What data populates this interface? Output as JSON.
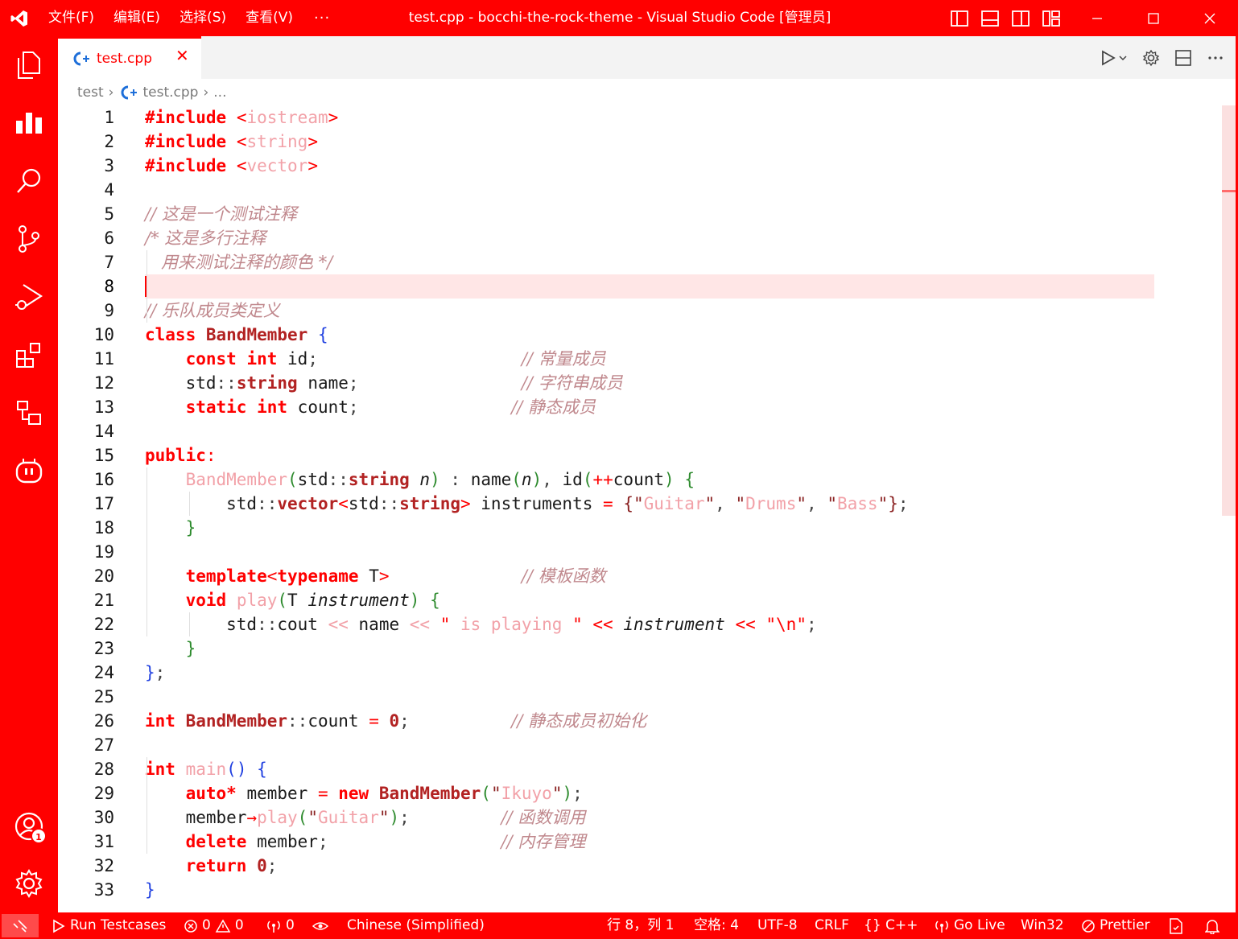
{
  "titlebar": {
    "menus": [
      "文件(F)",
      "编辑(E)",
      "选择(S)",
      "查看(V)"
    ],
    "more": "···",
    "title": "test.cpp - bocchi-the-rock-theme - Visual Studio Code [管理员]"
  },
  "tab": {
    "label": "test.cpp",
    "close": "✕"
  },
  "breadcrumb": {
    "folder": "test",
    "file": "test.cpp",
    "more": "..."
  },
  "editor": {
    "current_line": 8
  },
  "statusbar": {
    "run_testcases": "Run Testcases",
    "errors": "0",
    "warnings": "0",
    "ports": "0",
    "language_pack": "Chinese (Simplified)",
    "cursor": "行 8，列 1",
    "spaces": "空格: 4",
    "encoding": "UTF-8",
    "eol": "CRLF",
    "language": "{} C++",
    "go_live": "Go Live",
    "platform": "Win32",
    "prettier": "Prettier"
  },
  "accounts_badge": "1",
  "colors": {
    "accent": "#ff0000",
    "string": "#f2a1a8",
    "comment": "#c0888d",
    "current_line": "#ffe6e6"
  },
  "code_lines": [
    [
      [
        "pp",
        "#include"
      ],
      [
        "",
        "&nbsp;"
      ],
      [
        "op",
        "<"
      ],
      [
        "str",
        "iostream"
      ],
      [
        "op",
        ">"
      ]
    ],
    [
      [
        "pp",
        "#include"
      ],
      [
        "",
        "&nbsp;"
      ],
      [
        "op",
        "<"
      ],
      [
        "str",
        "string"
      ],
      [
        "op",
        ">"
      ]
    ],
    [
      [
        "pp",
        "#include"
      ],
      [
        "",
        "&nbsp;"
      ],
      [
        "op",
        "<"
      ],
      [
        "str",
        "vector"
      ],
      [
        "op",
        ">"
      ]
    ],
    [],
    [
      [
        "cm",
        "// 这是一个测试注释"
      ]
    ],
    [
      [
        "cm",
        "/* 这是多行注释"
      ]
    ],
    [
      [
        "cm",
        "   用来测试注释的颜色 */"
      ]
    ],
    [],
    [
      [
        "cm",
        "// 乐队成员类定义"
      ]
    ],
    [
      [
        "kw",
        "class"
      ],
      [
        "",
        "&nbsp;"
      ],
      [
        "ty",
        "BandMember"
      ],
      [
        "",
        "&nbsp;"
      ],
      [
        "br1",
        "{"
      ]
    ],
    [
      [
        "",
        "    "
      ],
      [
        "kw",
        "const"
      ],
      [
        "",
        "&nbsp;"
      ],
      [
        "kw",
        "int"
      ],
      [
        "",
        "&nbsp;id"
      ],
      [
        "pu",
        ";"
      ],
      [
        "",
        "                    "
      ],
      [
        "cm",
        "// 常量成员"
      ]
    ],
    [
      [
        "",
        "    std"
      ],
      [
        "pu",
        "::"
      ],
      [
        "ty",
        "string"
      ],
      [
        "",
        "&nbsp;name"
      ],
      [
        "pu",
        ";"
      ],
      [
        "",
        "                "
      ],
      [
        "cm",
        "// 字符串成员"
      ]
    ],
    [
      [
        "",
        "    "
      ],
      [
        "kw",
        "static"
      ],
      [
        "",
        "&nbsp;"
      ],
      [
        "kw",
        "int"
      ],
      [
        "",
        "&nbsp;count"
      ],
      [
        "pu",
        ";"
      ],
      [
        "",
        "               "
      ],
      [
        "cm",
        "// 静态成员"
      ]
    ],
    [],
    [
      [
        "kw",
        "public"
      ],
      [
        "op",
        ":"
      ]
    ],
    [
      [
        "",
        "    "
      ],
      [
        "fn",
        "BandMember"
      ],
      [
        "br2",
        "("
      ],
      [
        "",
        "std"
      ],
      [
        "pu",
        "::"
      ],
      [
        "ty",
        "string"
      ],
      [
        "",
        "&nbsp;"
      ],
      [
        "it",
        "n"
      ],
      [
        "br2",
        ")"
      ],
      [
        "",
        "&nbsp;"
      ],
      [
        "pu",
        ":"
      ],
      [
        "",
        "&nbsp;name"
      ],
      [
        "br2",
        "("
      ],
      [
        "it",
        "n"
      ],
      [
        "br2",
        ")"
      ],
      [
        "pu",
        ","
      ],
      [
        "",
        "&nbsp;id"
      ],
      [
        "br2",
        "("
      ],
      [
        "op",
        "++"
      ],
      [
        "",
        "count"
      ],
      [
        "br2",
        ")"
      ],
      [
        "",
        "&nbsp;"
      ],
      [
        "br2",
        "{"
      ]
    ],
    [
      [
        "",
        "        std"
      ],
      [
        "pu",
        "::"
      ],
      [
        "ty",
        "vector"
      ],
      [
        "op",
        "<"
      ],
      [
        "",
        "std"
      ],
      [
        "pu",
        "::"
      ],
      [
        "ty",
        "string"
      ],
      [
        "op",
        ">"
      ],
      [
        "",
        "&nbsp;instruments&nbsp;"
      ],
      [
        "op",
        "="
      ],
      [
        "",
        "&nbsp;"
      ],
      [
        "br3",
        "{"
      ],
      [
        "br3",
        "\""
      ],
      [
        "str",
        "Guitar"
      ],
      [
        "br3",
        "\""
      ],
      [
        "pu",
        ","
      ],
      [
        "",
        "&nbsp;"
      ],
      [
        "br3",
        "\""
      ],
      [
        "str",
        "Drums"
      ],
      [
        "br3",
        "\""
      ],
      [
        "pu",
        ","
      ],
      [
        "",
        "&nbsp;"
      ],
      [
        "br3",
        "\""
      ],
      [
        "str",
        "Bass"
      ],
      [
        "br3",
        "\""
      ],
      [
        "br3",
        "}"
      ],
      [
        "pu",
        ";"
      ]
    ],
    [
      [
        "",
        "    "
      ],
      [
        "br2",
        "}"
      ]
    ],
    [],
    [
      [
        "",
        "    "
      ],
      [
        "kw",
        "template"
      ],
      [
        "op",
        "<"
      ],
      [
        "kw",
        "typename"
      ],
      [
        "",
        "&nbsp;T"
      ],
      [
        "op",
        ">"
      ],
      [
        "",
        "             "
      ],
      [
        "cm",
        "// 模板函数"
      ]
    ],
    [
      [
        "",
        "    "
      ],
      [
        "kw",
        "void"
      ],
      [
        "",
        "&nbsp;"
      ],
      [
        "fn",
        "play"
      ],
      [
        "br2",
        "("
      ],
      [
        "",
        "T&nbsp;"
      ],
      [
        "it",
        "instrument"
      ],
      [
        "br2",
        ")"
      ],
      [
        "",
        "&nbsp;"
      ],
      [
        "br2",
        "{"
      ]
    ],
    [
      [
        "",
        "        std"
      ],
      [
        "pu",
        "::"
      ],
      [
        "",
        "cout&nbsp;"
      ],
      [
        "str",
        "&lt;&lt;"
      ],
      [
        "",
        "&nbsp;name&nbsp;"
      ],
      [
        "str",
        "&lt;&lt;"
      ],
      [
        "",
        "&nbsp;"
      ],
      [
        "op",
        "\""
      ],
      [
        "str",
        "&nbsp;is&nbsp;playing&nbsp;"
      ],
      [
        "op",
        "\""
      ],
      [
        "",
        "&nbsp;"
      ],
      [
        "op",
        "&lt;&lt;"
      ],
      [
        "",
        "&nbsp;"
      ],
      [
        "it",
        "instrument"
      ],
      [
        "",
        "&nbsp;"
      ],
      [
        "op",
        "&lt;&lt;"
      ],
      [
        "",
        "&nbsp;"
      ],
      [
        "op",
        "\"\\n\""
      ],
      [
        "pu",
        ";"
      ]
    ],
    [
      [
        "",
        "    "
      ],
      [
        "br2",
        "}"
      ]
    ],
    [
      [
        "br1",
        "}"
      ],
      [
        "pu",
        ";"
      ]
    ],
    [],
    [
      [
        "kw",
        "int"
      ],
      [
        "",
        "&nbsp;"
      ],
      [
        "ty",
        "BandMember"
      ],
      [
        "pu",
        "::"
      ],
      [
        "",
        "count&nbsp;"
      ],
      [
        "op",
        "="
      ],
      [
        "",
        "&nbsp;"
      ],
      [
        "ty",
        "0"
      ],
      [
        "pu",
        ";"
      ],
      [
        "",
        "          "
      ],
      [
        "cm",
        "// 静态成员初始化"
      ]
    ],
    [],
    [
      [
        "kw",
        "int"
      ],
      [
        "",
        "&nbsp;"
      ],
      [
        "fn",
        "main"
      ],
      [
        "br1",
        "()"
      ],
      [
        "",
        "&nbsp;"
      ],
      [
        "br1",
        "{"
      ]
    ],
    [
      [
        "",
        "    "
      ],
      [
        "kw",
        "auto*"
      ],
      [
        "",
        "&nbsp;member&nbsp;"
      ],
      [
        "op",
        "="
      ],
      [
        "",
        "&nbsp;"
      ],
      [
        "kw",
        "new"
      ],
      [
        "",
        "&nbsp;"
      ],
      [
        "ty",
        "BandMember"
      ],
      [
        "br2",
        "("
      ],
      [
        "br3",
        "\""
      ],
      [
        "str",
        "Ikuyo"
      ],
      [
        "br3",
        "\""
      ],
      [
        "br2",
        ")"
      ],
      [
        "pu",
        ";"
      ]
    ],
    [
      [
        "",
        "    member"
      ],
      [
        "op",
        "→"
      ],
      [
        "fn",
        "play"
      ],
      [
        "br2",
        "("
      ],
      [
        "br3",
        "\""
      ],
      [
        "str",
        "Guitar"
      ],
      [
        "br3",
        "\""
      ],
      [
        "br2",
        ")"
      ],
      [
        "pu",
        ";"
      ],
      [
        "",
        "         "
      ],
      [
        "cm",
        "// 函数调用"
      ]
    ],
    [
      [
        "",
        "    "
      ],
      [
        "kw",
        "delete"
      ],
      [
        "",
        "&nbsp;member"
      ],
      [
        "pu",
        ";"
      ],
      [
        "",
        "                 "
      ],
      [
        "cm",
        "// 内存管理"
      ]
    ],
    [
      [
        "",
        "    "
      ],
      [
        "kw",
        "return"
      ],
      [
        "",
        "&nbsp;"
      ],
      [
        "ty",
        "0"
      ],
      [
        "pu",
        ";"
      ]
    ],
    [
      [
        "br1",
        "}"
      ]
    ]
  ]
}
